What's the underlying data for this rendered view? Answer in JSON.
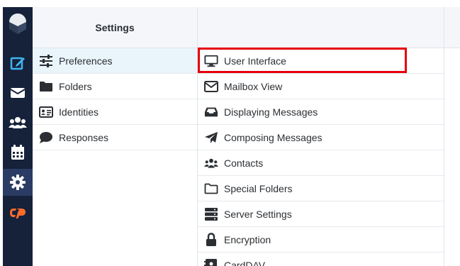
{
  "header": {
    "settings_title": "Settings"
  },
  "rail": {
    "items": [
      {
        "icon": "compose-icon",
        "active": false
      },
      {
        "icon": "mail-icon",
        "active": false
      },
      {
        "icon": "contacts-icon",
        "active": false
      },
      {
        "icon": "calendar-icon",
        "active": false
      },
      {
        "icon": "gear-icon",
        "active": true
      },
      {
        "icon": "cpanel-icon",
        "active": false
      }
    ]
  },
  "sections": [
    {
      "label": "Preferences",
      "icon": "sliders-icon",
      "selected": true
    },
    {
      "label": "Folders",
      "icon": "folder-icon",
      "selected": false
    },
    {
      "label": "Identities",
      "icon": "id-card-icon",
      "selected": false
    },
    {
      "label": "Responses",
      "icon": "speech-bubble-icon",
      "selected": false
    }
  ],
  "preferences": [
    {
      "label": "User Interface",
      "icon": "monitor-icon",
      "highlighted": true
    },
    {
      "label": "Mailbox View",
      "icon": "envelope-icon"
    },
    {
      "label": "Displaying Messages",
      "icon": "inbox-icon"
    },
    {
      "label": "Composing Messages",
      "icon": "paper-plane-icon"
    },
    {
      "label": "Contacts",
      "icon": "people-icon"
    },
    {
      "label": "Special Folders",
      "icon": "folder-outline-icon"
    },
    {
      "label": "Server Settings",
      "icon": "server-icon"
    },
    {
      "label": "Encryption",
      "icon": "lock-icon"
    },
    {
      "label": "CardDAV",
      "icon": "address-book-icon"
    }
  ],
  "colors": {
    "rail": "#16213a",
    "rail_active": "#2a3c63",
    "rail_icon": "#3db4ef",
    "highlight": "#e6000b",
    "cpanel": "#ff6c2c"
  }
}
